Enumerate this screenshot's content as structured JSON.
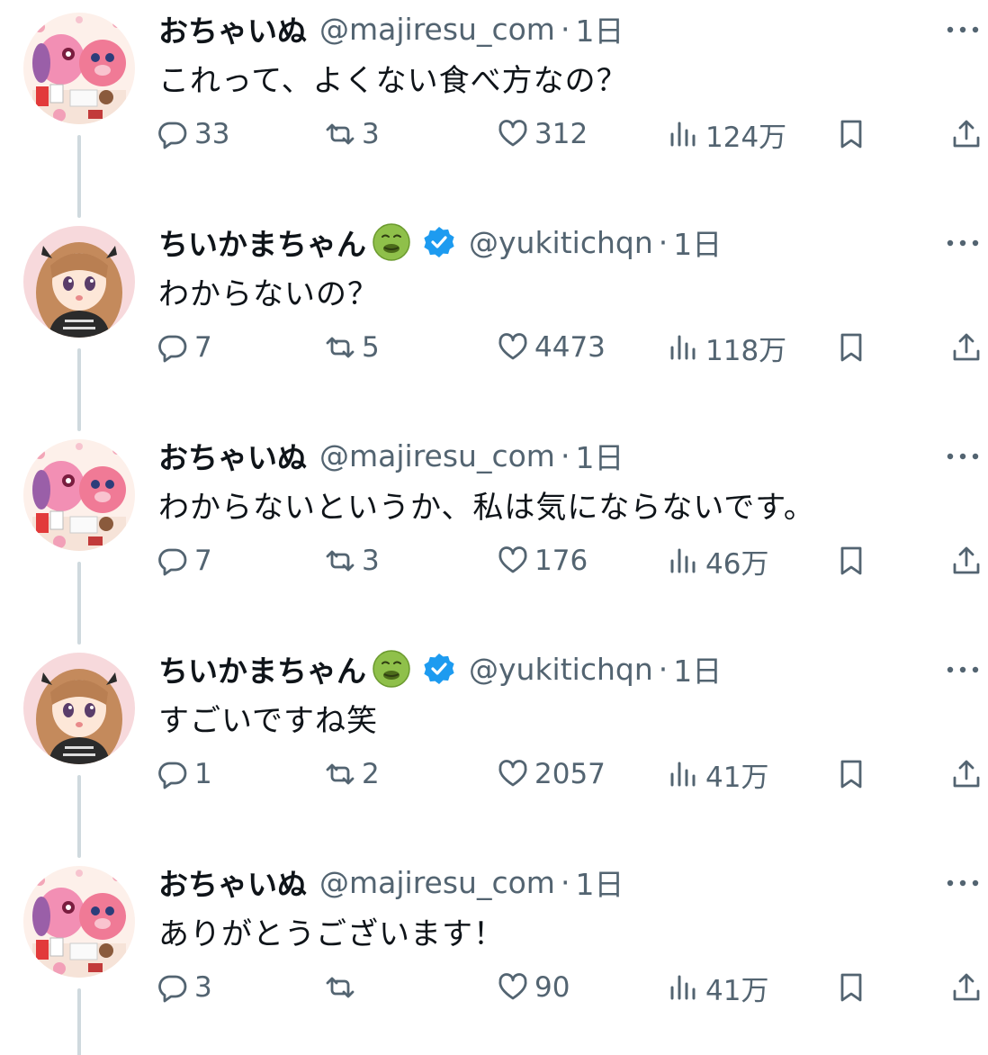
{
  "tweets": [
    {
      "user": "ochainu",
      "name": "おちゃいぬ",
      "handle": "@majiresu_com",
      "separator": "·",
      "time": "1日",
      "text": "これって、よくない食べ方なの？",
      "replies": "33",
      "retweets": "3",
      "likes": "312",
      "views": "124万"
    },
    {
      "user": "chiikama",
      "name": "ちいかまちゃん",
      "emoji_icon": "nauseated-face-icon",
      "verified": true,
      "handle": "@yukitichqn",
      "separator": "·",
      "time": "1日",
      "text": "わからないの？",
      "replies": "7",
      "retweets": "5",
      "likes": "4473",
      "views": "118万"
    },
    {
      "user": "ochainu",
      "name": "おちゃいぬ",
      "handle": "@majiresu_com",
      "separator": "·",
      "time": "1日",
      "text": "わからないというか、私は気にならないです。",
      "replies": "7",
      "retweets": "3",
      "likes": "176",
      "views": "46万"
    },
    {
      "user": "chiikama",
      "name": "ちいかまちゃん",
      "emoji_icon": "nauseated-face-icon",
      "verified": true,
      "handle": "@yukitichqn",
      "separator": "·",
      "time": "1日",
      "text": "すごいですね笑",
      "replies": "1",
      "retweets": "2",
      "likes": "2057",
      "views": "41万"
    },
    {
      "user": "ochainu",
      "name": "おちゃいぬ",
      "handle": "@majiresu_com",
      "separator": "·",
      "time": "1日",
      "text": "ありがとうございます！",
      "replies": "3",
      "retweets": "",
      "likes": "90",
      "views": "41万"
    }
  ],
  "colors": {
    "text": "#0f1419",
    "muted": "#536471",
    "thread_line": "#cfd9de",
    "verified": "#1d9bf0"
  },
  "icons": {
    "reply": "reply-icon",
    "retweet": "retweet-icon",
    "like": "like-icon",
    "views": "views-icon",
    "bookmark": "bookmark-icon",
    "share": "share-icon",
    "more": "more-icon"
  }
}
